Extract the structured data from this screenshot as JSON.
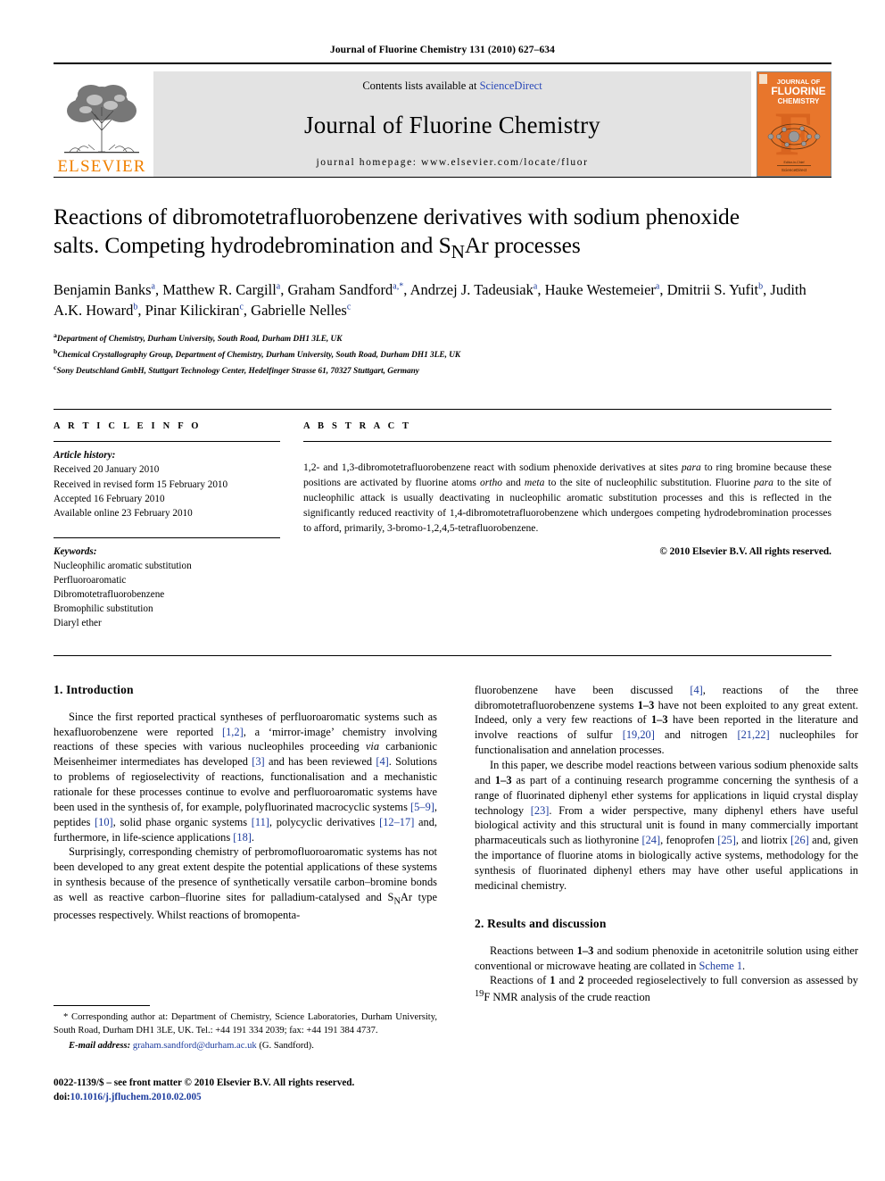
{
  "running_head": "Journal of Fluorine Chemistry 131 (2010) 627–634",
  "masthead": {
    "contents_prefix": "Contents lists available at ",
    "sciencedirect": "ScienceDirect",
    "journal_title": "Journal of Fluorine Chemistry",
    "homepage": "journal homepage: www.elsevier.com/locate/fluor",
    "publisher": "ELSEVIER",
    "cover_title_line1": "JOURNAL OF",
    "cover_title_line2": "FLUORINE",
    "cover_title_line3": "CHEMISTRY",
    "accent_orange": "#E8762C",
    "link_blue": "#2a49b8"
  },
  "article": {
    "title_line1": "Reactions of dibromotetrafluorobenzene derivatives with sodium phenoxide",
    "title_line2_a": "salts. Competing hydrodebromination and S",
    "title_line2_sub": "N",
    "title_line2_b": "Ar processes",
    "authors": [
      {
        "name": "Benjamin Banks",
        "sup": "a",
        "sep": ", "
      },
      {
        "name": "Matthew R. Cargill",
        "sup": "a",
        "sep": ", "
      },
      {
        "name": "Graham Sandford",
        "sup": "a,*",
        "sep": ", "
      },
      {
        "name": "Andrzej J. Tadeusiak",
        "sup": "a",
        "sep": ", "
      },
      {
        "name": "Hauke Westemeier",
        "sup": "a",
        "sep": ", "
      },
      {
        "name": "Dmitrii S. Yufit",
        "sup": "b",
        "sep": ", "
      },
      {
        "name": "Judith A.K. Howard",
        "sup": "b",
        "sep": ", "
      },
      {
        "name": "Pinar Kilickiran",
        "sup": "c",
        "sep": ", "
      },
      {
        "name": "Gabrielle Nelles",
        "sup": "c",
        "sep": ""
      }
    ],
    "affiliations": [
      {
        "mark": "a",
        "text": "Department of Chemistry, Durham University, South Road, Durham DH1 3LE, UK"
      },
      {
        "mark": "b",
        "text": "Chemical Crystallography Group, Department of Chemistry, Durham University, South Road, Durham DH1 3LE, UK"
      },
      {
        "mark": "c",
        "text": "Sony Deutschland GmbH, Stuttgart Technology Center, Hedelfinger Strasse 61, 70327 Stuttgart, Germany"
      }
    ]
  },
  "article_info": {
    "heading": "A R T I C L E   I N F O",
    "history_label": "Article history:",
    "history": [
      "Received 20 January 2010",
      "Received in revised form 15 February 2010",
      "Accepted 16 February 2010",
      "Available online 23 February 2010"
    ],
    "keywords_label": "Keywords:",
    "keywords": [
      "Nucleophilic aromatic substitution",
      "Perfluoroaromatic",
      "Dibromotetrafluorobenzene",
      "Bromophilic substitution",
      "Diaryl ether"
    ]
  },
  "abstract": {
    "heading": "A B S T R A C T",
    "p1_a": "1,2- and 1,3-dibromotetrafluorobenzene react with sodium phenoxide derivatives at sites ",
    "it_para1": "para",
    "p1_b": " to ring bromine because these positions are activated by fluorine atoms ",
    "it_ortho": "ortho",
    "p1_c": " and ",
    "it_meta": "meta",
    "p1_d": " to the site of nucleophilic substitution. Fluorine ",
    "it_para2": "para",
    "p1_e": " to the site of nucleophilic attack is usually deactivating in nucleophilic aromatic substitution processes and this is reflected in the significantly reduced reactivity of 1,4-dibromotetrafluorobenzene which undergoes competing hydrodebromination processes to afford, primarily, 3-bromo-1,2,4,5-tetrafluorobenzene.",
    "copyright": "© 2010 Elsevier B.V. All rights reserved."
  },
  "sections": {
    "intro_heading": "1. Introduction",
    "results_heading": "2. Results and discussion"
  },
  "body": {
    "left_p1_1": "Since the first reported practical syntheses of perfluoroaromatic systems such as hexafluorobenzene were reported ",
    "left_p1_ref1": "[1,2]",
    "left_p1_2": ", a ‘mirror-image’ chemistry involving reactions of these species with various nucleophiles proceeding ",
    "left_p1_via": "via",
    "left_p1_3": " carbanionic Meisenheimer intermediates has developed ",
    "left_p1_ref2": "[3]",
    "left_p1_4": " and has been reviewed ",
    "left_p1_ref3": "[4]",
    "left_p1_5": ". Solutions to problems of regioselectivity of reactions, functionalisation and a mechanistic rationale for these processes continue to evolve and perfluoroaromatic systems have been used in the synthesis of, for example, polyfluorinated macrocyclic systems ",
    "left_p1_ref4": "[5–9]",
    "left_p1_6": ", peptides ",
    "left_p1_ref5": "[10]",
    "left_p1_7": ", solid phase organic systems ",
    "left_p1_ref6": "[11]",
    "left_p1_8": ", polycyclic derivatives ",
    "left_p1_ref7": "[12–17]",
    "left_p1_9": " and, furthermore, in life-science applications ",
    "left_p1_ref8": "[18]",
    "left_p1_10": ".",
    "left_p2_1": "Surprisingly, corresponding chemistry of perbromofluoroaromatic systems has not been developed to any great extent despite the potential applications of these systems in synthesis because of the presence of synthetically versatile carbon–bromine bonds as well as reactive carbon–fluorine sites for palladium-catalysed and S",
    "left_p2_sub": "N",
    "left_p2_2": "Ar type processes respectively. Whilst reactions of bromopenta-",
    "right_p1_1": "fluorobenzene have been discussed ",
    "right_p1_ref1": "[4]",
    "right_p1_2": ", reactions of the three dibromotetrafluorobenzene systems ",
    "right_p1_cpd1": "1–3",
    "right_p1_3": " have not been exploited to any great extent. Indeed, only a very few reactions of ",
    "right_p1_cpd2": "1–3",
    "right_p1_4": " have been reported in the literature and involve reactions of sulfur ",
    "right_p1_ref2": "[19,20]",
    "right_p1_5": " and nitrogen ",
    "right_p1_ref3": "[21,22]",
    "right_p1_6": " nucleophiles for functionalisation and annelation processes.",
    "right_p2_1": "In this paper, we describe model reactions between various sodium phenoxide salts and ",
    "right_p2_cpd1": "1–3",
    "right_p2_2": " as part of a continuing research programme concerning the synthesis of a range of fluorinated diphenyl ether systems for applications in liquid crystal display technology ",
    "right_p2_ref1": "[23]",
    "right_p2_3": ". From a wider perspective, many diphenyl ethers have useful biological activity and this structural unit is found in many commercially important pharmaceuticals such as liothyronine ",
    "right_p2_ref2": "[24]",
    "right_p2_4": ", fenoprofen ",
    "right_p2_ref3": "[25]",
    "right_p2_5": ", and liotrix ",
    "right_p2_ref4": "[26]",
    "right_p2_6": " and, given the importance of fluorine atoms in biologically active systems, methodology for the synthesis of fluorinated diphenyl ethers may have other useful applications in medicinal chemistry.",
    "right_p3_1": "Reactions between ",
    "right_p3_cpd1": "1–3",
    "right_p3_2": " and sodium phenoxide in acetonitrile solution using either conventional or microwave heating are collated in ",
    "right_p3_link": "Scheme 1",
    "right_p3_3": ".",
    "right_p4_1": "Reactions of ",
    "right_p4_cpd1": "1",
    "right_p4_2": " and ",
    "right_p4_cpd2": "2",
    "right_p4_3": " proceeded regioselectively to full conversion as assessed by ",
    "right_p4_sup": "19",
    "right_p4_4": "F NMR analysis of the crude reaction"
  },
  "footnote": {
    "text": "* Corresponding author at: Department of Chemistry, Science Laboratories, Durham University, South Road, Durham DH1 3LE, UK. Tel.: +44 191 334 2039; fax: +44 191 384 4737.",
    "email_label": "E-mail address:",
    "email": "graham.sandford@durham.ac.uk",
    "email_suffix": "(G. Sandford)."
  },
  "issn": {
    "line1": "0022-1139/$ – see front matter © 2010 Elsevier B.V. All rights reserved.",
    "doi_label": "doi:",
    "doi": "10.1016/j.jfluchem.2010.02.005"
  }
}
